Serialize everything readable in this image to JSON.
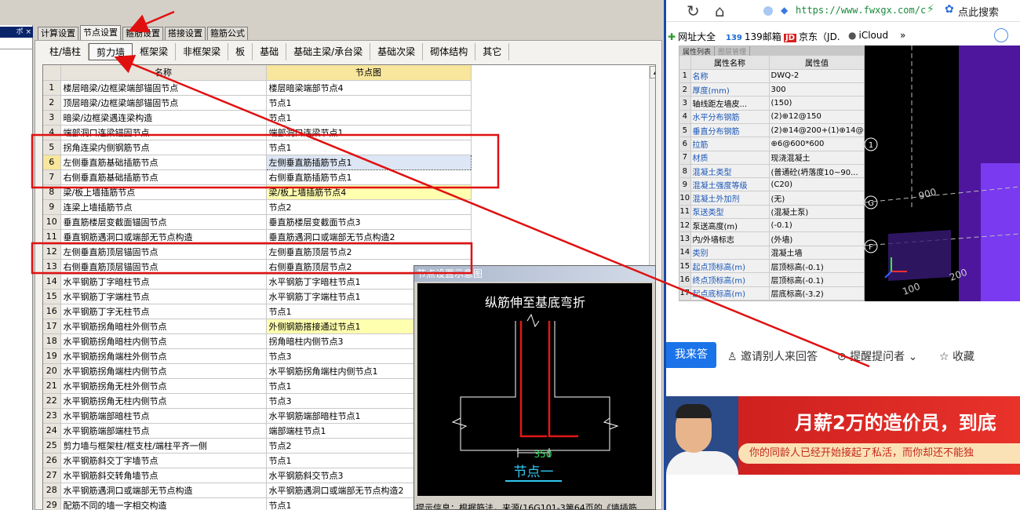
{
  "left_panel": {
    "pin_label": "ポ ×"
  },
  "main_tabs": [
    {
      "label": "计算设置",
      "active": false
    },
    {
      "label": "节点设置",
      "active": true
    },
    {
      "label": "箍筋设置",
      "active": false
    },
    {
      "label": "搭接设置",
      "active": false
    },
    {
      "label": "箍筋公式",
      "active": false
    }
  ],
  "sub_tabs": [
    {
      "label": "柱/墙柱",
      "active": false
    },
    {
      "label": "剪力墙",
      "active": true
    },
    {
      "label": "框架梁",
      "active": false
    },
    {
      "label": "非框架梁",
      "active": false
    },
    {
      "label": "板",
      "active": false
    },
    {
      "label": "基础",
      "active": false
    },
    {
      "label": "基础主梁/承台梁",
      "active": false
    },
    {
      "label": "基础次梁",
      "active": false
    },
    {
      "label": "砌体结构",
      "active": false
    },
    {
      "label": "其它",
      "active": false
    }
  ],
  "grid": {
    "col_name": "名称",
    "col_node": "节点图",
    "rows": [
      {
        "n": "1",
        "name": "楼层暗梁/边框梁端部锚固节点",
        "node": "楼层暗梁端部节点4"
      },
      {
        "n": "2",
        "name": "顶层暗梁/边框梁端部锚固节点",
        "node": "节点1"
      },
      {
        "n": "3",
        "name": "暗梁/边框梁遇连梁构造",
        "node": "节点1"
      },
      {
        "n": "4",
        "name": "端部洞口连梁锚固节点",
        "node": "端部洞口连梁节点1"
      },
      {
        "n": "5",
        "name": "拐角连梁内侧钢筋节点",
        "node": "节点1"
      },
      {
        "n": "6",
        "name": "左侧垂直筋基础插筋节点",
        "node": "左侧垂直筋插筋节点1",
        "selected": true
      },
      {
        "n": "7",
        "name": "右侧垂直筋基础插筋节点",
        "node": "右侧垂直筋插筋节点1"
      },
      {
        "n": "8",
        "name": "梁/板上墙插筋节点",
        "node": "梁/板上墙插筋节点4",
        "highlight": true
      },
      {
        "n": "9",
        "name": "连梁上墙插筋节点",
        "node": "节点2"
      },
      {
        "n": "10",
        "name": "垂直筋楼层变截面锚固节点",
        "node": "垂直筋楼层变截面节点3"
      },
      {
        "n": "11",
        "name": "垂直钢筋遇洞口或端部无节点构造",
        "node": "垂直筋遇洞口或端部无节点构造2"
      },
      {
        "n": "12",
        "name": "左侧垂直筋顶层锚固节点",
        "node": "左侧垂直筋顶层节点2"
      },
      {
        "n": "13",
        "name": "右侧垂直筋顶层锚固节点",
        "node": "右侧垂直筋顶层节点2"
      },
      {
        "n": "14",
        "name": "水平钢筋丁字暗柱节点",
        "node": "水平钢筋丁字暗柱节点1"
      },
      {
        "n": "15",
        "name": "水平钢筋丁字端柱节点",
        "node": "水平钢筋丁字端柱节点1"
      },
      {
        "n": "16",
        "name": "水平钢筋丁字无柱节点",
        "node": "节点1"
      },
      {
        "n": "17",
        "name": "水平钢筋拐角暗柱外侧节点",
        "node": "外侧钢筋搭接通过节点1",
        "highlight": true
      },
      {
        "n": "18",
        "name": "水平钢筋拐角暗柱内侧节点",
        "node": "拐角暗柱内侧节点3"
      },
      {
        "n": "19",
        "name": "水平钢筋拐角端柱外侧节点",
        "node": "节点3"
      },
      {
        "n": "20",
        "name": "水平钢筋拐角端柱内侧节点",
        "node": "水平钢筋拐角端柱内侧节点1"
      },
      {
        "n": "21",
        "name": "水平钢筋拐角无柱外侧节点",
        "node": "节点1"
      },
      {
        "n": "22",
        "name": "水平钢筋拐角无柱内侧节点",
        "node": "节点3"
      },
      {
        "n": "23",
        "name": "水平钢筋端部暗柱节点",
        "node": "水平钢筋端部暗柱节点1"
      },
      {
        "n": "24",
        "name": "水平钢筋端部端柱节点",
        "node": "端部端柱节点1"
      },
      {
        "n": "25",
        "name": "剪力墙与框架柱/框支柱/端柱平齐一侧",
        "node": "节点2"
      },
      {
        "n": "26",
        "name": "水平钢筋斜交丁字墙节点",
        "node": "节点1"
      },
      {
        "n": "27",
        "name": "水平钢筋斜交转角墙节点",
        "node": "水平钢筋斜交节点3"
      },
      {
        "n": "28",
        "name": "水平钢筋遇洞口或端部无节点构造",
        "node": "水平钢筋遇洞口或端部无节点构造2"
      },
      {
        "n": "29",
        "name": "配筋不同的墙一字相交构造",
        "node": "节点1"
      }
    ]
  },
  "preview": {
    "title": "节点设置示意图",
    "diagram_title": "纵筋伸至基底弯折",
    "dim_label": "350",
    "node_label": "节点一",
    "hint": "提示信息：根据筋法，来源(16G101-3第64页的《墙插筋"
  },
  "browser": {
    "url": "https://www.fwxgx.com/c",
    "search_hint": "点此搜索",
    "bookmarks": [
      {
        "icon": "✚",
        "label": "网址大全"
      },
      {
        "icon": "139",
        "label": "139邮箱"
      },
      {
        "icon": "JD",
        "label": "京东（JD."
      },
      {
        "icon": "",
        "label": "iCloud"
      },
      {
        "icon": "",
        "label": "»"
      }
    ],
    "prop_tabs": [
      "属性列表",
      "图层管理"
    ],
    "prop_cols": [
      "属性名称",
      "属性值"
    ],
    "props": [
      {
        "n": "1",
        "name": "名称",
        "value": "DWQ-2",
        "blue": true
      },
      {
        "n": "2",
        "name": "厚度(mm)",
        "value": "300",
        "blue": true
      },
      {
        "n": "3",
        "name": "轴线距左墙皮...",
        "value": "(150)",
        "blue": false
      },
      {
        "n": "4",
        "name": "水平分布钢筋",
        "value": "(2)⊕12@150",
        "blue": true
      },
      {
        "n": "5",
        "name": "垂直分布钢筋",
        "value": "(2)⊕14@200+(1)⊕14@",
        "blue": true
      },
      {
        "n": "6",
        "name": "拉筋",
        "value": "⊕6@600*600",
        "blue": true
      },
      {
        "n": "7",
        "name": "材质",
        "value": "现浇混凝土",
        "blue": true
      },
      {
        "n": "8",
        "name": "混凝土类型",
        "value": "(普通砼(坍落度10~90...",
        "blue": true
      },
      {
        "n": "9",
        "name": "混凝土强度等级",
        "value": "(C20)",
        "blue": true
      },
      {
        "n": "10",
        "name": "混凝土外加剂",
        "value": "(无)",
        "blue": true
      },
      {
        "n": "11",
        "name": "泵送类型",
        "value": "(混凝土泵)",
        "blue": true
      },
      {
        "n": "12",
        "name": "泵送高度(m)",
        "value": "(-0.1)",
        "blue": false
      },
      {
        "n": "13",
        "name": "内/外墙标志",
        "value": "(外墙)",
        "blue": false
      },
      {
        "n": "14",
        "name": "类别",
        "value": "混凝土墙",
        "blue": true
      },
      {
        "n": "15",
        "name": "起点顶标高(m)",
        "value": "层顶标高(-0.1)",
        "blue": true
      },
      {
        "n": "16",
        "name": "终点顶标高(m)",
        "value": "层顶标高(-0.1)",
        "blue": true
      },
      {
        "n": "17",
        "name": "起点底标高(m)",
        "value": "层底标高(-3.2)",
        "blue": true
      }
    ],
    "cad_labels": [
      "1",
      "G",
      "F",
      "900",
      "200",
      "100"
    ],
    "answer_btn": "我来答",
    "invite": "邀请别人来回答",
    "remind": "提醒提问者",
    "collect": "收藏",
    "ad_title": "月薪2万的造价员，到底",
    "ad_sub": "你的同龄人已经开始接起了私活，而你却还不能独"
  },
  "colors": {
    "annotation_red": "#e01010",
    "browser_blue": "#1a73e8"
  }
}
